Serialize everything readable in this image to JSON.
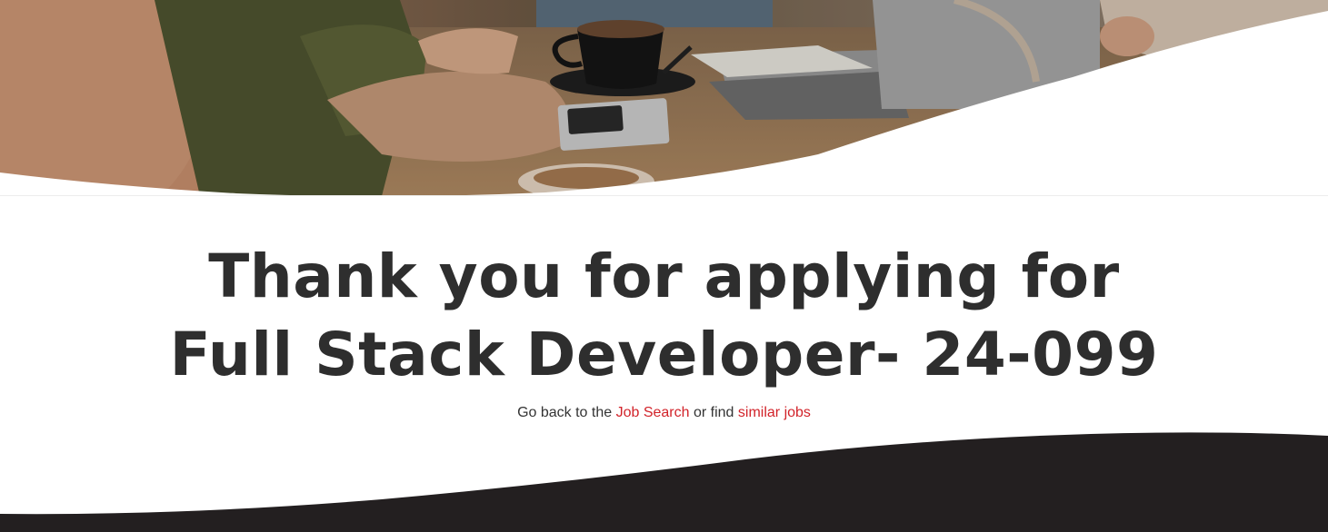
{
  "hero": {
    "image_alt": "people-meeting-at-table-photo"
  },
  "confirmation": {
    "title": "Thank you for applying for Full Stack Developer- 24-099",
    "back_prefix": "Go back to the",
    "job_search_link": "Job Search",
    "or_text": "or find",
    "similar_jobs_link": "similar jobs"
  },
  "colors": {
    "link": "#d2232a",
    "heading": "#2e2e2e",
    "footer_bg": "#231f20"
  }
}
